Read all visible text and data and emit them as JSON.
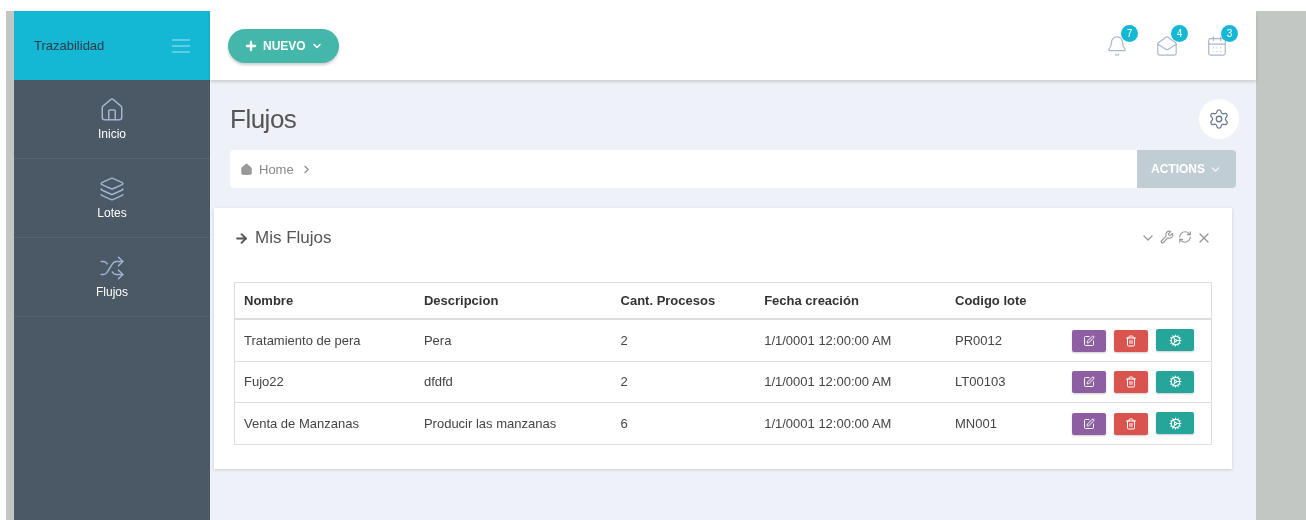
{
  "sidebar": {
    "brand": "Trazabilidad",
    "items": [
      {
        "kind": "home",
        "label": "Inicio"
      },
      {
        "kind": "layers",
        "label": "Lotes"
      },
      {
        "kind": "shuffle",
        "label": "Flujos"
      }
    ]
  },
  "header": {
    "new_button": "NUEVO",
    "notifications": [
      {
        "kind": "bell",
        "count": "7"
      },
      {
        "kind": "mail",
        "count": "4"
      },
      {
        "kind": "calendar",
        "count": "3"
      }
    ]
  },
  "page": {
    "title": "Flujos",
    "breadcrumb": [
      "Home"
    ],
    "actions_button": "ACTIONS"
  },
  "panel": {
    "title": "Mis Flujos",
    "table": {
      "columns": [
        "Nombre",
        "Descripcion",
        "Cant. Procesos",
        "Fecha creación",
        "Codigo lote"
      ],
      "rows": [
        [
          "Tratamiento de pera",
          "Pera",
          "2",
          "1/1/0001 12:00:00 AM",
          "PR0012"
        ],
        [
          "Fujo22",
          "dfdfd",
          "2",
          "1/1/0001 12:00:00 AM",
          "LT00103"
        ],
        [
          "Venta de Manzanas",
          "Producir las manzanas",
          "6",
          "1/1/0001 12:00:00 AM",
          "MN001"
        ]
      ]
    }
  }
}
